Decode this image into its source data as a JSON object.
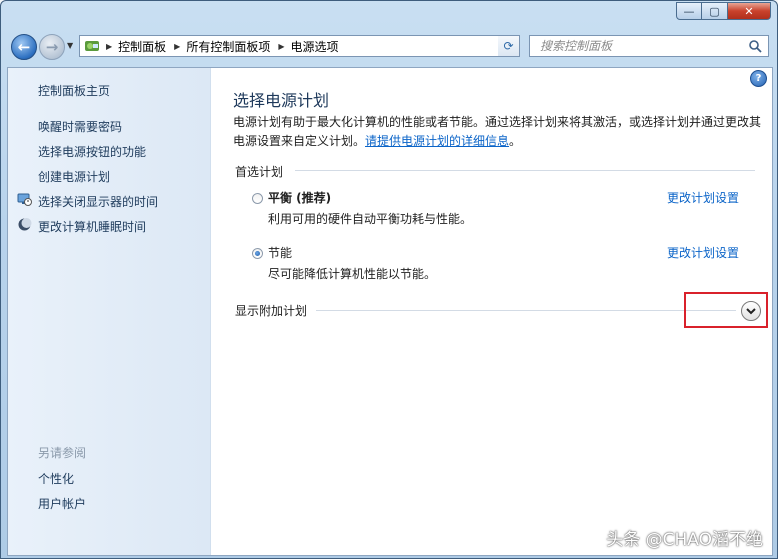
{
  "window": {
    "controls": {
      "minimize": "—",
      "maximize": "▢",
      "close": "✕"
    },
    "accent": "#1c5aa8"
  },
  "nav": {
    "breadcrumbs": [
      "控制面板",
      "所有控制面板项",
      "电源选项"
    ],
    "search_placeholder": "搜索控制面板"
  },
  "sidebar": {
    "home": "控制面板主页",
    "links": [
      {
        "label": "唤醒时需要密码"
      },
      {
        "label": "选择电源按钮的功能"
      },
      {
        "label": "创建电源计划"
      },
      {
        "label": "选择关闭显示器的时间",
        "icon": "monitor-clock-icon"
      },
      {
        "label": "更改计算机睡眠时间",
        "icon": "moon-icon"
      }
    ],
    "see_also_title": "另请参阅",
    "see_also": [
      "个性化",
      "用户帐户"
    ]
  },
  "main": {
    "title": "选择电源计划",
    "description": "电源计划有助于最大化计算机的性能或者节能。通过选择计划来将其激活，或选择计划并通过更改其电源设置来自定义计划。",
    "description_link": "请提供电源计划的详细信息",
    "description_end": "。",
    "preferred_label": "首选计划",
    "plans": [
      {
        "name": "平衡 (推荐)",
        "desc": "利用可用的硬件自动平衡功耗与性能。",
        "selected": false,
        "link": "更改计划设置"
      },
      {
        "name": "节能",
        "desc": "尽可能降低计算机性能以节能。",
        "selected": true,
        "link": "更改计划设置"
      }
    ],
    "show_more_label": "显示附加计划",
    "help_glyph": "?"
  },
  "watermark": "头条 @CHAO滔不绝"
}
